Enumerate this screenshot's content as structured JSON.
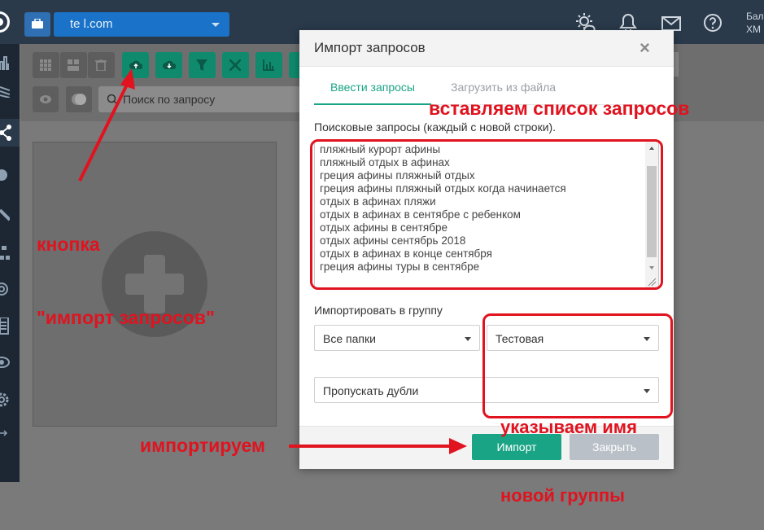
{
  "topbar": {
    "domain": "te        l.com",
    "right_text_line1": "Бал",
    "right_text_line2": "ХМ"
  },
  "toolbar": {
    "search_placeholder": "Поиск по запросу"
  },
  "modal": {
    "title": "Импорт запросов",
    "close_symbol": "×",
    "tabs": [
      {
        "label": "Ввести запросы",
        "active": true
      },
      {
        "label": "Загрузить из файла",
        "active": false
      }
    ],
    "queries_label": "Поисковые запросы (каждый с новой строки).",
    "queries": [
      "пляжный курорт афины",
      "пляжный отдых в афинах",
      "греция афины пляжный отдых",
      "греция афины пляжный отдых когда начинается",
      "отдых в афинах пляжи",
      "отдых в афинах в сентябре с ребенком",
      "отдых афины в сентябре",
      "отдых афины сентябрь 2018",
      "отдых в афинах в конце сентября",
      "греция афины туры в сентябре"
    ],
    "group_label": "Импортировать в группу",
    "folder_select": "Все папки",
    "group_select": "Тестовая",
    "duplicates_select": "Пропускать дубли",
    "import_button": "Импорт",
    "close_button": "Закрыть"
  },
  "annotations": {
    "paste_list": "вставляем список запросов",
    "button_note_line1": "кнопка",
    "button_note_line2": "\"импорт запросов\"",
    "group_note_line1": "указываем имя",
    "group_note_line2": "новой группы",
    "import_note": "импортируем"
  },
  "colors": {
    "accent": "#1aa486",
    "annotation_red": "#e0131f",
    "topbar": "#2a3a4b"
  }
}
